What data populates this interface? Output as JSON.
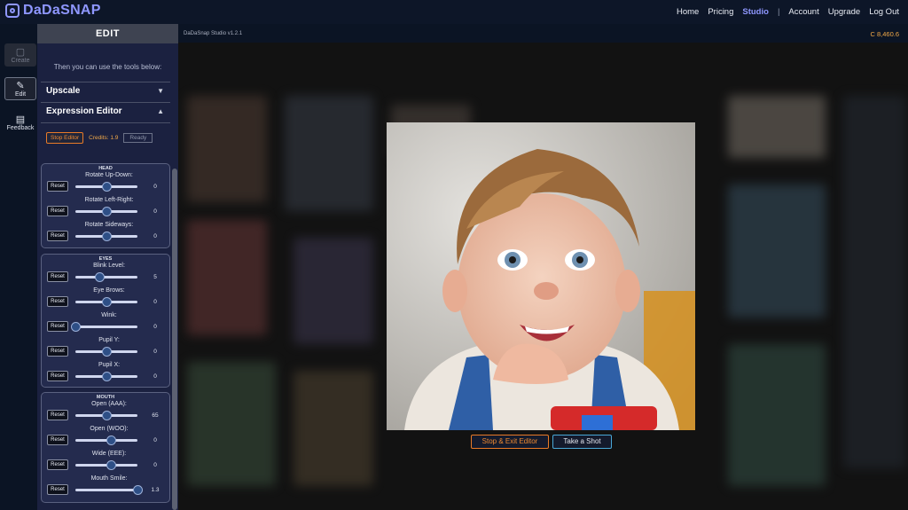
{
  "app": {
    "logo_text": "DaDaSNAP",
    "version": "DaDaSnap Studio v1.2.1",
    "credits": "C 8,460.6",
    "accent": "#8f97ff"
  },
  "nav": {
    "home": "Home",
    "pricing": "Pricing",
    "studio": "Studio",
    "separator": "|",
    "account": "Account",
    "upgrade": "Upgrade",
    "logout": "Log Out"
  },
  "strip": {
    "create": "Create",
    "edit": "Edit",
    "feedback": "Feedback"
  },
  "panel": {
    "title": "EDIT",
    "note": "Then you can use the tools below:",
    "upscale": "Upscale",
    "expression_editor": "Expression Editor",
    "stop_editor": "Stop Editor",
    "credits": "Credits: 1.9",
    "status": "Ready",
    "reset": "Reset",
    "head": {
      "label": "HEAD",
      "sliders": [
        {
          "name": "Rotate Up-Down:",
          "value": "0",
          "pos": 0.5
        },
        {
          "name": "Rotate Left-Right:",
          "value": "0",
          "pos": 0.5
        },
        {
          "name": "Rotate Sideways:",
          "value": "0",
          "pos": 0.5
        }
      ]
    },
    "eyes": {
      "label": "EYES",
      "sliders": [
        {
          "name": "Blink Level:",
          "value": "5",
          "pos": 0.38
        },
        {
          "name": "Eye Brows:",
          "value": "0",
          "pos": 0.5
        },
        {
          "name": "Wink:",
          "value": "0",
          "pos": 0.0
        },
        {
          "name": "Pupil Y:",
          "value": "0",
          "pos": 0.5
        },
        {
          "name": "Pupil X:",
          "value": "0",
          "pos": 0.5
        }
      ]
    },
    "mouth": {
      "label": "MOUTH",
      "sliders": [
        {
          "name": "Open (AAA):",
          "value": "65",
          "pos": 0.5
        },
        {
          "name": "Open (WOO):",
          "value": "0",
          "pos": 0.57
        },
        {
          "name": "Wide (EEE):",
          "value": "0",
          "pos": 0.57
        },
        {
          "name": "Mouth Smile:",
          "value": "1.3",
          "pos": 1.0
        }
      ]
    }
  },
  "actions": {
    "stop_exit": "Stop & Exit Editor",
    "take_shot": "Take a Shot"
  },
  "colors": {
    "stop": "#e87a28",
    "shot": "#4aa8d8",
    "credits": "#f0a848"
  }
}
